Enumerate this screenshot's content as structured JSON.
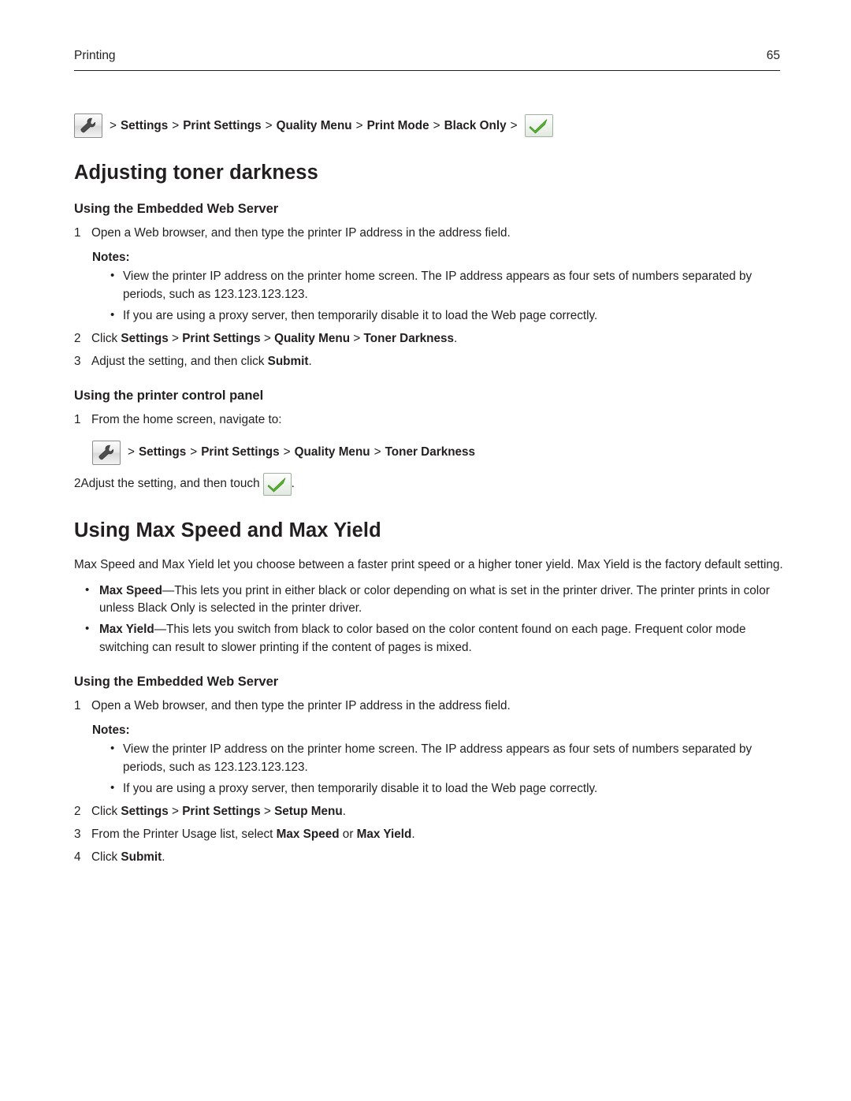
{
  "header": {
    "section": "Printing",
    "page_number": "65"
  },
  "nav_line_1": {
    "wrench_icon": "wrench-icon",
    "segments": [
      "Settings",
      "Print Settings",
      "Quality Menu",
      "Print Mode",
      "Black Only"
    ],
    "separator": ">",
    "check_icon": "green-check-icon"
  },
  "section1": {
    "title": "Adjusting toner darkness",
    "sub1": "Using the Embedded Web Server",
    "step1": "Open a Web browser, and then type the printer IP address in the address field.",
    "notes_label": "Notes:",
    "notes": [
      "View the printer IP address on the printer home screen. The IP address appears as four sets of numbers separated by periods, such as 123.123.123.123.",
      "If you are using a proxy server, then temporarily disable it to load the Web page correctly."
    ],
    "step2_prefix": "Click ",
    "step2_bold_a": "Settings",
    "step2_bold_b": "Print Settings",
    "step2_bold_c": "Quality Menu",
    "step2_bold_d": "Toner Darkness",
    "step2_suffix": ".",
    "step3_prefix": "Adjust the setting, and then click ",
    "step3_bold": "Submit",
    "step3_suffix": ".",
    "sub2": "Using the printer control panel",
    "cp_step1": "From the home screen, navigate to:",
    "cp_path_segments": [
      "Settings",
      "Print Settings",
      "Quality Menu",
      "Toner Darkness"
    ],
    "cp_step2_prefix": "Adjust the setting, and then touch",
    "cp_step2_suffix": "."
  },
  "section2": {
    "title": "Using Max Speed and Max Yield",
    "intro": "Max Speed and Max Yield let you choose between a faster print speed or a higher toner yield. Max Yield is the factory default setting.",
    "bullets": [
      {
        "term": "Max Speed",
        "text": "—This lets you print in either black or color depending on what is set in the printer driver. The printer prints in color unless Black Only is selected in the printer driver."
      },
      {
        "term": "Max Yield",
        "text": "—This lets you switch from black to color based on the color content found on each page. Frequent color mode switching can result to slower printing if the content of pages is mixed."
      }
    ],
    "sub1": "Using the Embedded Web Server",
    "step1": "Open a Web browser, and then type the printer IP address in the address field.",
    "notes_label": "Notes:",
    "notes": [
      "View the printer IP address on the printer home screen. The IP address appears as four sets of numbers separated by periods, such as 123.123.123.123.",
      "If you are using a proxy server, then temporarily disable it to load the Web page correctly."
    ],
    "step2_prefix": "Click ",
    "step2_bold_a": "Settings",
    "step2_bold_b": "Print Settings",
    "step2_bold_c": "Setup Menu",
    "step2_suffix": ".",
    "step3_prefix": "From the Printer Usage list, select ",
    "step3_bold_a": "Max Speed",
    "step3_mid": " or ",
    "step3_bold_b": "Max Yield",
    "step3_suffix": ".",
    "step4_prefix": "Click ",
    "step4_bold": "Submit",
    "step4_suffix": "."
  },
  "numbers": {
    "one": "1",
    "two": "2",
    "three": "3",
    "four": "4"
  },
  "colors": {
    "text": "#231f20",
    "check_green": "#5ab031"
  }
}
